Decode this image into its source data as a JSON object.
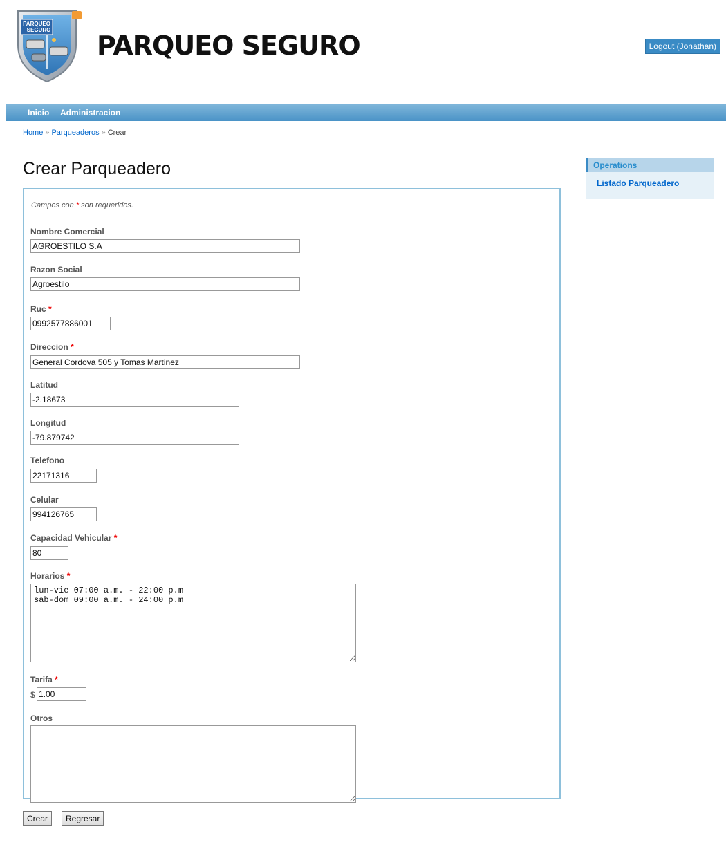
{
  "header": {
    "logo_text": "PARQUEO SEGURO",
    "brand": "PARQUEO SEGURO",
    "logout_label": "Logout (Jonathan)"
  },
  "nav": {
    "items": [
      "Inicio",
      "Administracion"
    ]
  },
  "breadcrumbs": {
    "home": "Home",
    "parent": "Parqueaderos",
    "current": "Crear",
    "separator": "»"
  },
  "page_title": "Crear Parqueadero",
  "sidebar": {
    "header": "Operations",
    "link": "Listado Parqueadero"
  },
  "form": {
    "note_before": "Campos con ",
    "note_star": "*",
    "note_after": " son requeridos.",
    "required_marker": "*",
    "nombre_label": "Nombre Comercial",
    "nombre_value": "AGROESTILO S.A",
    "razon_label": "Razon Social",
    "razon_value": "Agroestilo",
    "ruc_label": "Ruc",
    "ruc_value": "0992577886001",
    "direccion_label": "Direccion",
    "direccion_value": "General Cordova 505 y Tomas Martinez",
    "latitud_label": "Latitud",
    "latitud_value": "-2.18673",
    "longitud_label": "Longitud",
    "longitud_value": "-79.879742",
    "telefono_label": "Telefono",
    "telefono_value": "22171316",
    "celular_label": "Celular",
    "celular_value": "994126765",
    "capacidad_label": "Capacidad Vehicular",
    "capacidad_value": "80",
    "horarios_label": "Horarios",
    "horarios_value": "lun-vie 07:00 a.m. - 22:00 p.m\nsab-dom 09:00 a.m. - 24:00 p.m",
    "tarifa_label": "Tarifa",
    "tarifa_prefix": "$",
    "tarifa_value": "1.00",
    "otros_label": "Otros",
    "otros_value": ""
  },
  "buttons": {
    "crear": "Crear",
    "regresar": "Regresar"
  },
  "colors": {
    "nav_bar": "#4a93c7",
    "accent": "#3a8bc5",
    "required": "#e00000",
    "link": "#0066cc"
  }
}
